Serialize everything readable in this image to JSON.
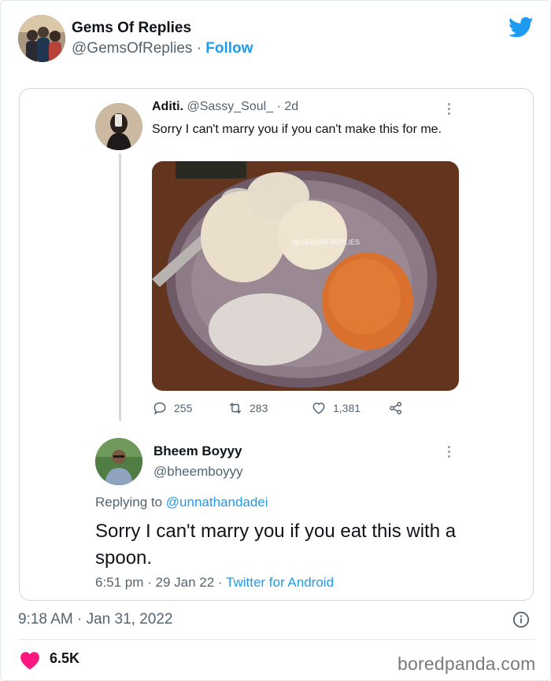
{
  "tweet": {
    "author_name": "Gems Of Replies",
    "author_handle": "@GemsOfReplies",
    "separator": " · ",
    "follow_label": "Follow",
    "timestamp": "9:18 AM · Jan 31, 2022",
    "likes": "6.5K",
    "accent_color": "#1d9bf0",
    "like_color": "#f91880"
  },
  "original": {
    "name": "Aditi.",
    "handle": "@Sassy_Soul_",
    "age": "· 2d",
    "text": "Sorry I can't marry you if you can't make this for me.",
    "image_watermark": "@GEMSOFREPLIES",
    "replies": "255",
    "retweets": "283",
    "likes": "1,381"
  },
  "reply": {
    "name": "Bheem Boyyy",
    "handle": "@bheemboyyy",
    "replying_prefix": "Replying to ",
    "replying_handle": "@unnathandadei",
    "text": "Sorry I can't marry you if you eat this with a spoon.",
    "meta_time": "6:51 pm · 29 Jan 22 · ",
    "meta_client": "Twitter for Android"
  },
  "watermark": "boredpanda.com"
}
